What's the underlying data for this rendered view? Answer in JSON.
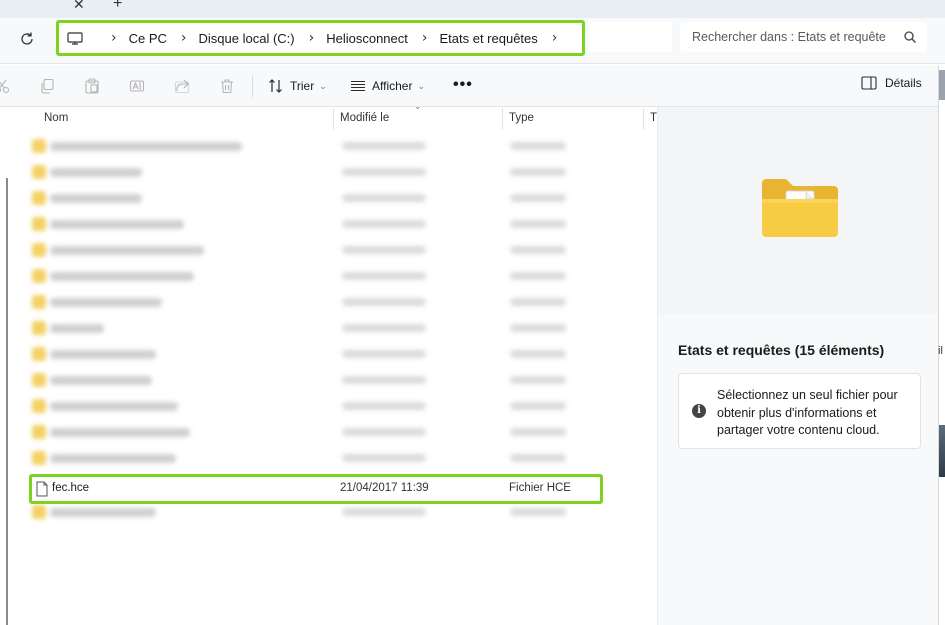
{
  "tabstrip": {
    "close_glyph": "✕",
    "new_glyph": "+"
  },
  "address": {
    "crumbs": [
      "Ce PC",
      "Disque local (C:)",
      "Heliosconnect",
      "Etats et requêtes"
    ],
    "search_placeholder": "Rechercher dans : Etats et requête"
  },
  "toolbar": {
    "sort_label": "Trier",
    "view_label": "Afficher",
    "more_label": "•••",
    "details_label": "Détails"
  },
  "columns": {
    "name": "Nom",
    "modified": "Modifié le",
    "type": "Type",
    "size": "T"
  },
  "highlighted_file": {
    "name": "fec.hce",
    "modified": "21/04/2017 11:39",
    "type": "Fichier HCE"
  },
  "details": {
    "title": "Etats et requêtes (15 éléments)",
    "info_text": "Sélectionnez un seul fichier pour obtenir plus d'informations et partager votre contenu cloud."
  },
  "edge": {
    "cut_text": "il"
  },
  "colors": {
    "highlight": "#7ed321",
    "folder": "#f2c94c"
  }
}
